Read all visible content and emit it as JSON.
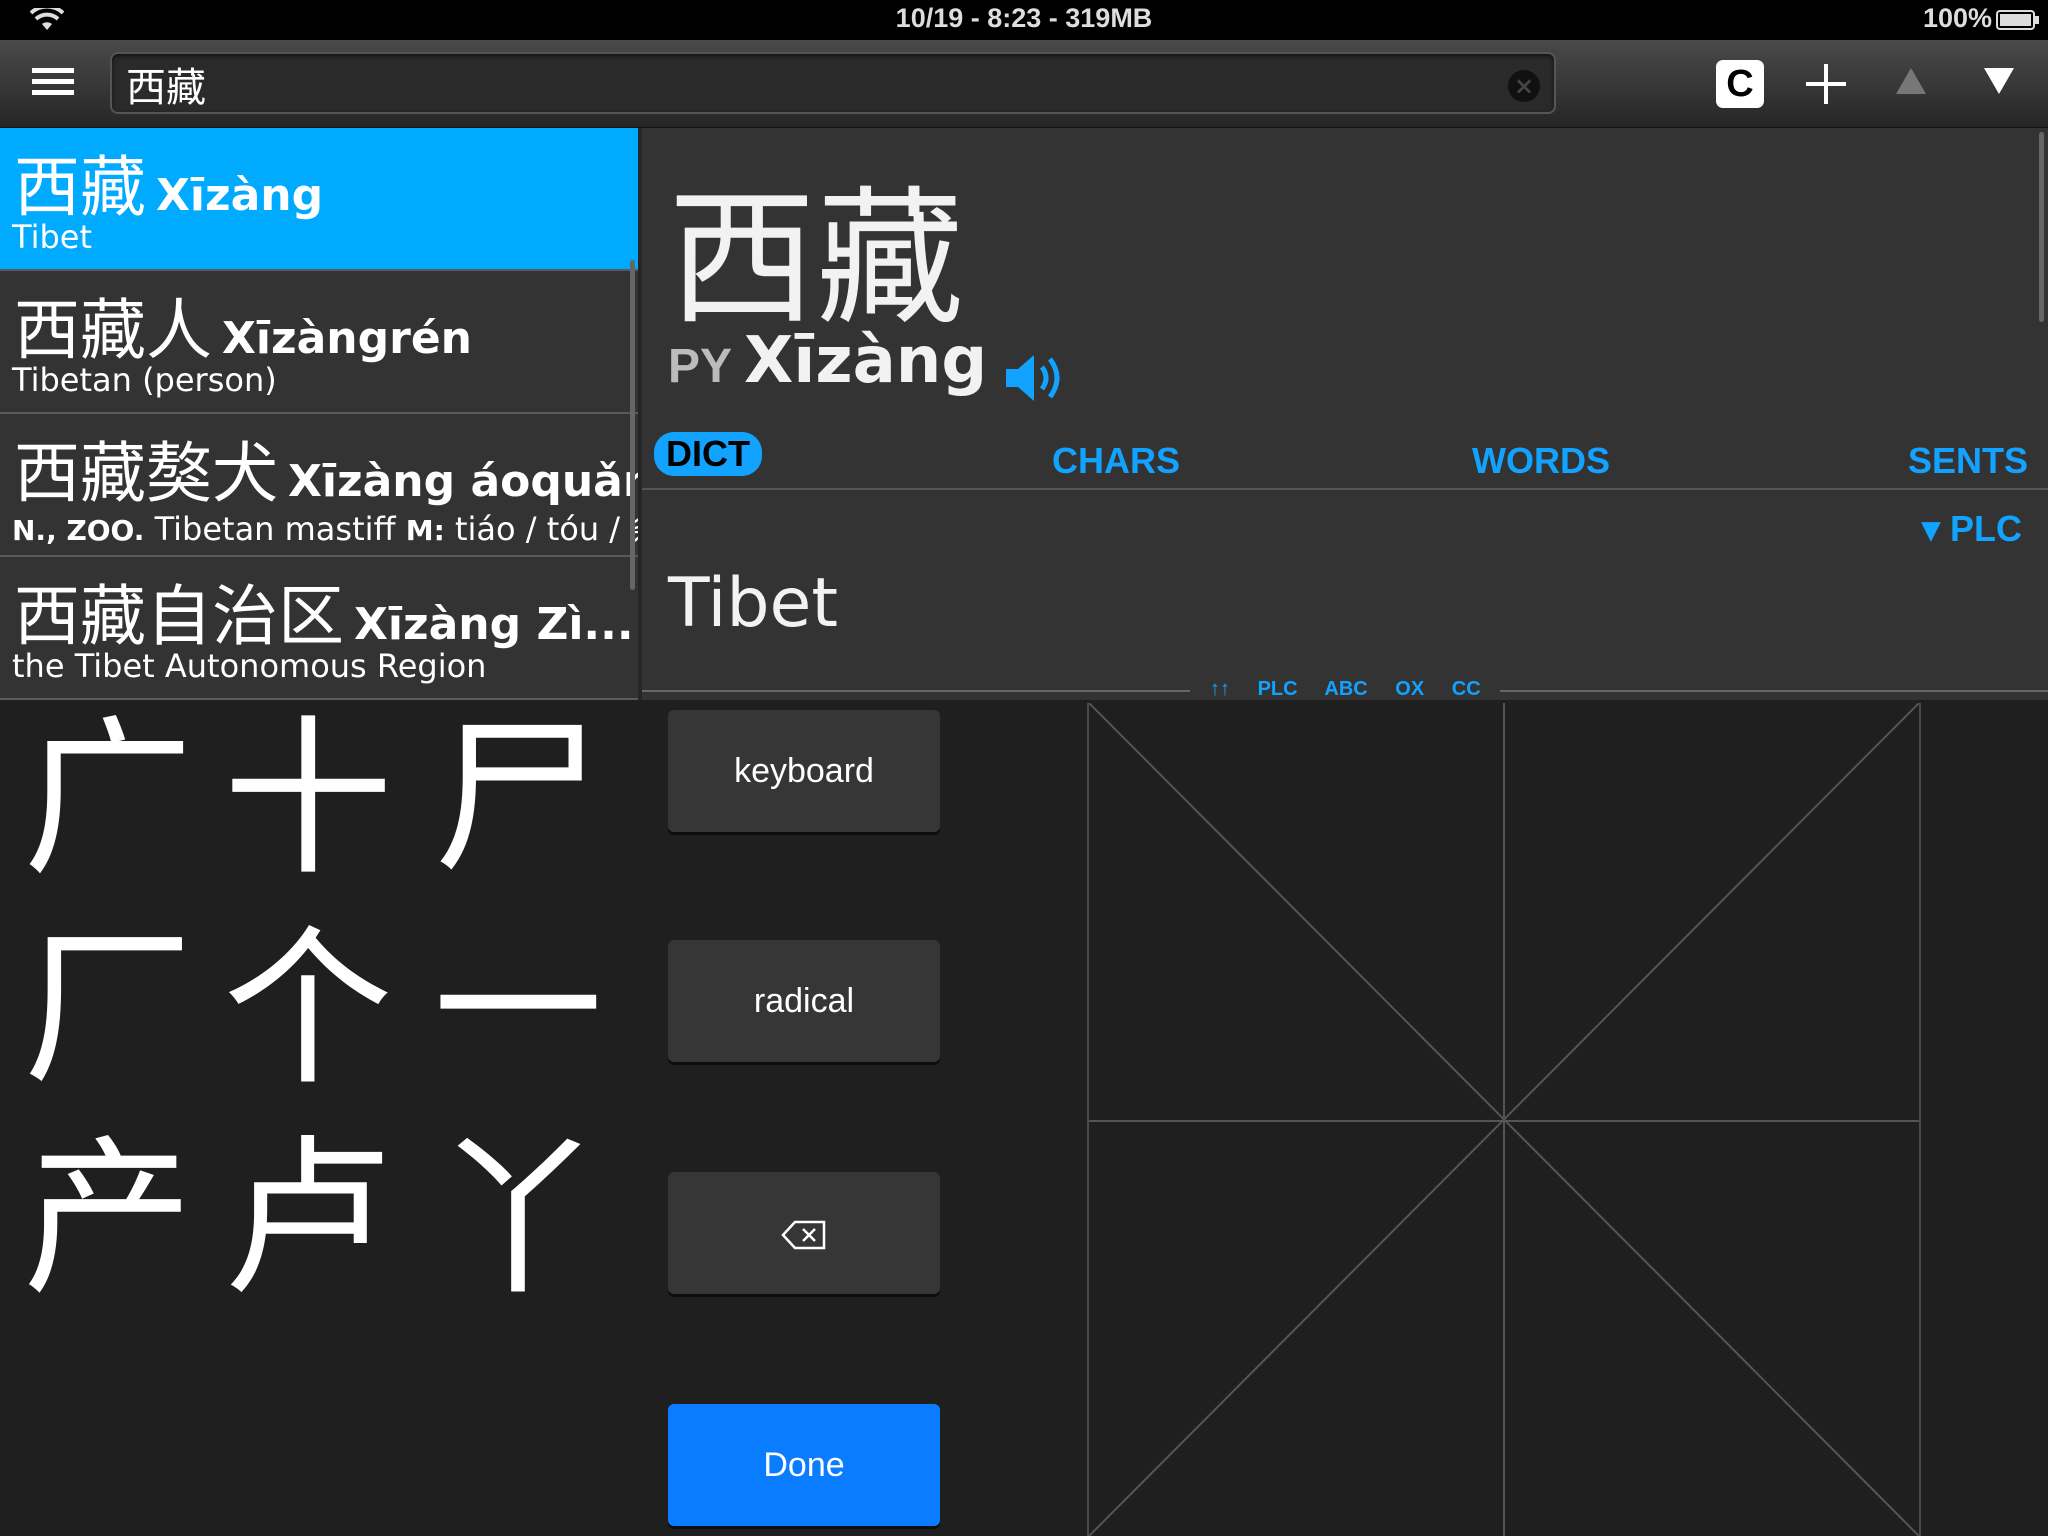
{
  "status_bar": {
    "center_text": "10/19 - 8:23 - 319MB",
    "battery_text": "100%"
  },
  "search": {
    "value": "西藏"
  },
  "toolbar": {
    "clipboard_label": "C"
  },
  "results": [
    {
      "hanzi": "西藏",
      "pinyin": "Xīzàng",
      "definition": "Tibet"
    },
    {
      "hanzi": "西藏人",
      "pinyin": "Xīzàngrén",
      "definition": "Tibetan (person)"
    },
    {
      "hanzi": "西藏獒犬",
      "pinyin": "Xīzàng áoquǎn",
      "definition_prefix": "N., ZOO.",
      "definition": " Tibetan mastiff ",
      "measure_label": "M:",
      "measure": " tiáo / tóu / 条"
    },
    {
      "hanzi": "西藏自治区",
      "pinyin": "Xīzàng Zì...",
      "definition": "the Tibet Autonomous Region"
    }
  ],
  "detail": {
    "hanzi": "西藏",
    "py_tag": "PY",
    "pinyin": "Xīzàng",
    "tabs": [
      "DICT",
      "CHARS",
      "WORDS",
      "SENTS"
    ],
    "source_toggle": "▾ PLC",
    "definition": "Tibet",
    "mini_sources": [
      "↑↑",
      "PLC",
      "ABC",
      "OX",
      "CC"
    ]
  },
  "handwriting": {
    "candidates": [
      "广",
      "十",
      "尸",
      "厂",
      "个",
      "一",
      "产",
      "卢",
      "丫"
    ],
    "keys": {
      "keyboard": "keyboard",
      "radical": "radical",
      "done": "Done"
    }
  },
  "colors": {
    "accent": "#11a3ff",
    "selected_row": "#00aaff",
    "done_button": "#0a7cff"
  }
}
